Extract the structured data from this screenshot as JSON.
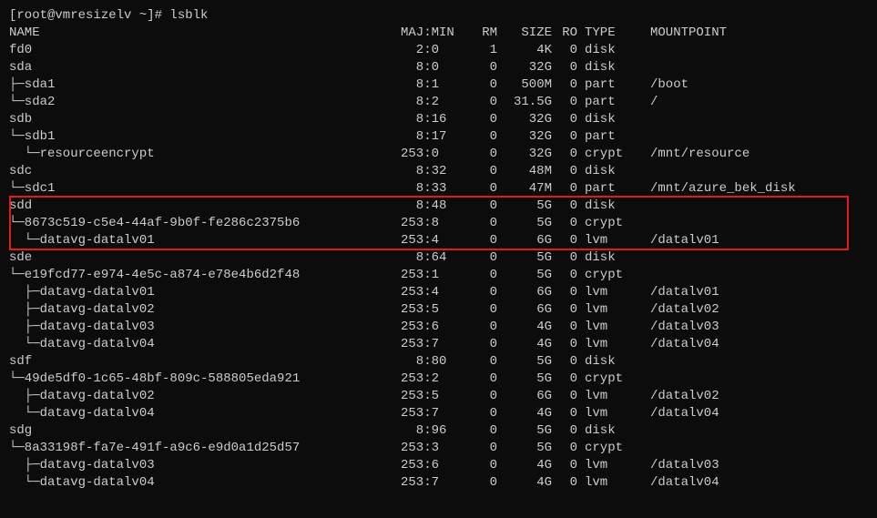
{
  "prompt": "[root@vmresizelv ~]# lsblk",
  "header": {
    "name": "NAME",
    "majmin": "MAJ:MIN",
    "rm": "RM",
    "size": "SIZE",
    "ro": "RO",
    "type": "TYPE",
    "mnt": "MOUNTPOINT"
  },
  "rows": [
    {
      "name": "fd0",
      "majmin": "  2:0",
      "rm": "1",
      "size": "4K",
      "ro": "0",
      "type": "disk",
      "mnt": ""
    },
    {
      "name": "sda",
      "majmin": "  8:0",
      "rm": "0",
      "size": "32G",
      "ro": "0",
      "type": "disk",
      "mnt": ""
    },
    {
      "name": "├─sda1",
      "majmin": "  8:1",
      "rm": "0",
      "size": "500M",
      "ro": "0",
      "type": "part",
      "mnt": "/boot"
    },
    {
      "name": "└─sda2",
      "majmin": "  8:2",
      "rm": "0",
      "size": "31.5G",
      "ro": "0",
      "type": "part",
      "mnt": "/"
    },
    {
      "name": "sdb",
      "majmin": "  8:16",
      "rm": "0",
      "size": "32G",
      "ro": "0",
      "type": "disk",
      "mnt": ""
    },
    {
      "name": "└─sdb1",
      "majmin": "  8:17",
      "rm": "0",
      "size": "32G",
      "ro": "0",
      "type": "part",
      "mnt": ""
    },
    {
      "name": "  └─resourceencrypt",
      "majmin": "253:0",
      "rm": "0",
      "size": "32G",
      "ro": "0",
      "type": "crypt",
      "mnt": "/mnt/resource"
    },
    {
      "name": "sdc",
      "majmin": "  8:32",
      "rm": "0",
      "size": "48M",
      "ro": "0",
      "type": "disk",
      "mnt": ""
    },
    {
      "name": "└─sdc1",
      "majmin": "  8:33",
      "rm": "0",
      "size": "47M",
      "ro": "0",
      "type": "part",
      "mnt": "/mnt/azure_bek_disk"
    },
    {
      "name": "sdd",
      "majmin": "  8:48",
      "rm": "0",
      "size": "5G",
      "ro": "0",
      "type": "disk",
      "mnt": "",
      "hilite": true
    },
    {
      "name": "└─8673c519-c5e4-44af-9b0f-fe286c2375b6",
      "majmin": "253:8",
      "rm": "0",
      "size": "5G",
      "ro": "0",
      "type": "crypt",
      "mnt": ""
    },
    {
      "name": "  └─datavg-datalv01",
      "majmin": "253:4",
      "rm": "0",
      "size": "6G",
      "ro": "0",
      "type": "lvm",
      "mnt": "/datalv01"
    },
    {
      "name": "sde",
      "majmin": "  8:64",
      "rm": "0",
      "size": "5G",
      "ro": "0",
      "type": "disk",
      "mnt": ""
    },
    {
      "name": "└─e19fcd77-e974-4e5c-a874-e78e4b6d2f48",
      "majmin": "253:1",
      "rm": "0",
      "size": "5G",
      "ro": "0",
      "type": "crypt",
      "mnt": ""
    },
    {
      "name": "  ├─datavg-datalv01",
      "majmin": "253:4",
      "rm": "0",
      "size": "6G",
      "ro": "0",
      "type": "lvm",
      "mnt": "/datalv01"
    },
    {
      "name": "  ├─datavg-datalv02",
      "majmin": "253:5",
      "rm": "0",
      "size": "6G",
      "ro": "0",
      "type": "lvm",
      "mnt": "/datalv02"
    },
    {
      "name": "  ├─datavg-datalv03",
      "majmin": "253:6",
      "rm": "0",
      "size": "4G",
      "ro": "0",
      "type": "lvm",
      "mnt": "/datalv03"
    },
    {
      "name": "  └─datavg-datalv04",
      "majmin": "253:7",
      "rm": "0",
      "size": "4G",
      "ro": "0",
      "type": "lvm",
      "mnt": "/datalv04"
    },
    {
      "name": "sdf",
      "majmin": "  8:80",
      "rm": "0",
      "size": "5G",
      "ro": "0",
      "type": "disk",
      "mnt": ""
    },
    {
      "name": "└─49de5df0-1c65-48bf-809c-588805eda921",
      "majmin": "253:2",
      "rm": "0",
      "size": "5G",
      "ro": "0",
      "type": "crypt",
      "mnt": ""
    },
    {
      "name": "  ├─datavg-datalv02",
      "majmin": "253:5",
      "rm": "0",
      "size": "6G",
      "ro": "0",
      "type": "lvm",
      "mnt": "/datalv02"
    },
    {
      "name": "  └─datavg-datalv04",
      "majmin": "253:7",
      "rm": "0",
      "size": "4G",
      "ro": "0",
      "type": "lvm",
      "mnt": "/datalv04"
    },
    {
      "name": "sdg",
      "majmin": "  8:96",
      "rm": "0",
      "size": "5G",
      "ro": "0",
      "type": "disk",
      "mnt": ""
    },
    {
      "name": "└─8a33198f-fa7e-491f-a9c6-e9d0a1d25d57",
      "majmin": "253:3",
      "rm": "0",
      "size": "5G",
      "ro": "0",
      "type": "crypt",
      "mnt": ""
    },
    {
      "name": "  ├─datavg-datalv03",
      "majmin": "253:6",
      "rm": "0",
      "size": "4G",
      "ro": "0",
      "type": "lvm",
      "mnt": "/datalv03"
    },
    {
      "name": "  └─datavg-datalv04",
      "majmin": "253:7",
      "rm": "0",
      "size": "4G",
      "ro": "0",
      "type": "lvm",
      "mnt": "/datalv04"
    }
  ]
}
